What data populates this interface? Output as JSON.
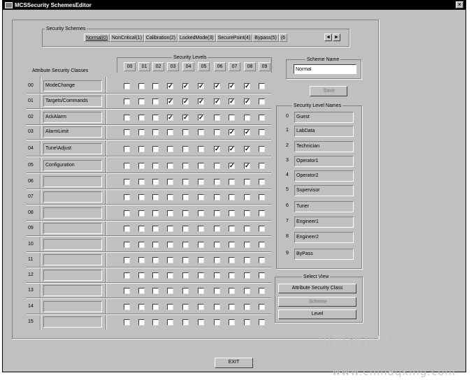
{
  "window": {
    "title": "MCSSecurity SchemesEditor",
    "close": "×"
  },
  "schemes": {
    "group_label": "Security Schemes",
    "tabs": [
      "Normal(0)",
      "NonCritical(1)",
      "Calibration(2)",
      "LockedMode(3)",
      "SecurePoint(4)",
      "Bypass(5)",
      "(6"
    ],
    "active_tab": 0,
    "prev": "◄",
    "next": "►"
  },
  "levels": {
    "group_label": "Security Levels",
    "headers": [
      "00",
      "01",
      "02",
      "03",
      "04",
      "05",
      "06",
      "07",
      "08",
      "09"
    ]
  },
  "classes": {
    "header": "Attribute Security Classes",
    "rows": [
      {
        "num": "00",
        "name": "ModeChange",
        "checks": [
          0,
          0,
          0,
          1,
          1,
          1,
          1,
          1,
          1,
          0
        ]
      },
      {
        "num": "01",
        "name": "Targets/Commands",
        "checks": [
          0,
          0,
          0,
          1,
          1,
          1,
          1,
          1,
          1,
          0
        ]
      },
      {
        "num": "02",
        "name": "AckAlarm",
        "checks": [
          0,
          0,
          0,
          1,
          1,
          1,
          0,
          0,
          0,
          0
        ]
      },
      {
        "num": "03",
        "name": "AlarmLimit",
        "checks": [
          0,
          0,
          0,
          0,
          0,
          0,
          0,
          1,
          1,
          0
        ]
      },
      {
        "num": "04",
        "name": "Tune\\Adjust",
        "checks": [
          0,
          0,
          0,
          0,
          0,
          0,
          1,
          1,
          1,
          0
        ]
      },
      {
        "num": "05",
        "name": "Configuration",
        "checks": [
          0,
          0,
          0,
          0,
          0,
          0,
          0,
          1,
          1,
          0
        ]
      },
      {
        "num": "06",
        "name": "",
        "checks": [
          0,
          0,
          0,
          0,
          0,
          0,
          0,
          0,
          0,
          0
        ]
      },
      {
        "num": "07",
        "name": "",
        "checks": [
          0,
          0,
          0,
          0,
          0,
          0,
          0,
          0,
          0,
          0
        ]
      },
      {
        "num": "08",
        "name": "",
        "checks": [
          0,
          0,
          0,
          0,
          0,
          0,
          0,
          0,
          0,
          0
        ]
      },
      {
        "num": "09",
        "name": "",
        "checks": [
          0,
          0,
          0,
          0,
          0,
          0,
          0,
          0,
          0,
          0
        ]
      },
      {
        "num": "10",
        "name": "",
        "checks": [
          0,
          0,
          0,
          0,
          0,
          0,
          0,
          0,
          0,
          0
        ]
      },
      {
        "num": "11",
        "name": "",
        "checks": [
          0,
          0,
          0,
          0,
          0,
          0,
          0,
          0,
          0,
          0
        ]
      },
      {
        "num": "12",
        "name": "",
        "checks": [
          0,
          0,
          0,
          0,
          0,
          0,
          0,
          0,
          0,
          0
        ]
      },
      {
        "num": "13",
        "name": "",
        "checks": [
          0,
          0,
          0,
          0,
          0,
          0,
          0,
          0,
          0,
          0
        ]
      },
      {
        "num": "14",
        "name": "",
        "checks": [
          0,
          0,
          0,
          0,
          0,
          0,
          0,
          0,
          0,
          0
        ]
      },
      {
        "num": "15",
        "name": "",
        "checks": [
          0,
          0,
          0,
          0,
          0,
          0,
          0,
          0,
          0,
          0
        ]
      }
    ]
  },
  "scheme_name": {
    "group_label": "Scheme Name",
    "value": "Normal",
    "save_label": "Save"
  },
  "level_names": {
    "group_label": "Security Level Names",
    "items": [
      {
        "num": "0",
        "name": "Guest"
      },
      {
        "num": "1",
        "name": "LabData"
      },
      {
        "num": "2",
        "name": "Technician"
      },
      {
        "num": "3",
        "name": "Operator1"
      },
      {
        "num": "4",
        "name": "Operator2"
      },
      {
        "num": "5",
        "name": "Supervisor"
      },
      {
        "num": "6",
        "name": "Tuner"
      },
      {
        "num": "7",
        "name": "Engineer1"
      },
      {
        "num": "8",
        "name": "Engineer2"
      },
      {
        "num": "9",
        "name": "ByPass"
      }
    ]
  },
  "select_view": {
    "group_label": "Select View",
    "buttons": [
      "Attribute Security Class",
      "Scheme",
      "Level"
    ]
  },
  "exit_label": "EXIT",
  "watermark": {
    "cn": "中国期刊网",
    "url": "www.chinaqking.com"
  }
}
